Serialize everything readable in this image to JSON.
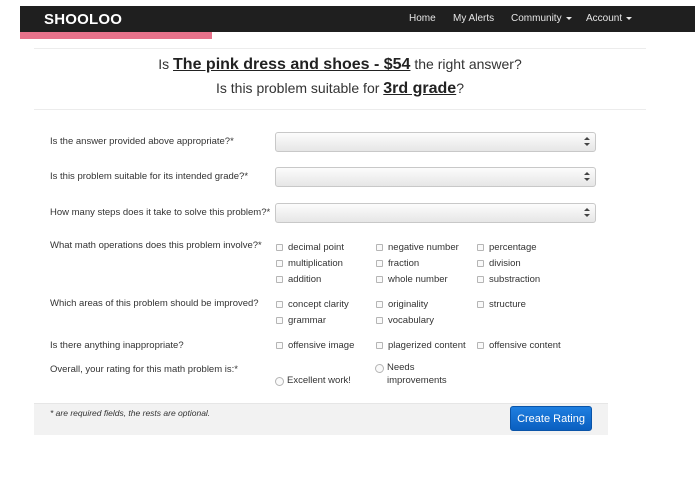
{
  "nav": {
    "brand": "SHOOLOO",
    "home": "Home",
    "alerts": "My Alerts",
    "community": "Community",
    "account": "Account"
  },
  "headline": {
    "q1_pre": "Is ",
    "answer": "The pink dress and shoes - $54",
    "q1_post": " the right answer?",
    "q2_pre": "Is this problem suitable for ",
    "grade": "3rd grade",
    "q2_post": "?"
  },
  "form": {
    "q_answer": "Is the answer provided above appropriate?*",
    "q_grade": "Is this problem suitable for its intended grade?*",
    "q_steps": "How many steps does it take to solve this problem?*",
    "q_operations": "What math operations does this problem involve?*",
    "operations": [
      "decimal point",
      "negative number",
      "percentage",
      "multiplication",
      "fraction",
      "division",
      "addition",
      "whole number",
      "substraction"
    ],
    "q_improve": "Which areas of this problem should be improved?",
    "improve": [
      "concept clarity",
      "originality",
      "structure",
      "grammar",
      "vocabulary"
    ],
    "q_inappropriate": "Is there anything inappropriate?",
    "inappropriate": [
      "offensive image",
      "plagerized content",
      "offensive content"
    ],
    "q_rating": "Overall, your rating for this math problem is:*",
    "rating_excellent": "Excellent work!",
    "rating_needs_1": "Needs",
    "rating_needs_2": "improvements",
    "footnote": "* are required fields, the rests are optional.",
    "submit": "Create Rating"
  }
}
